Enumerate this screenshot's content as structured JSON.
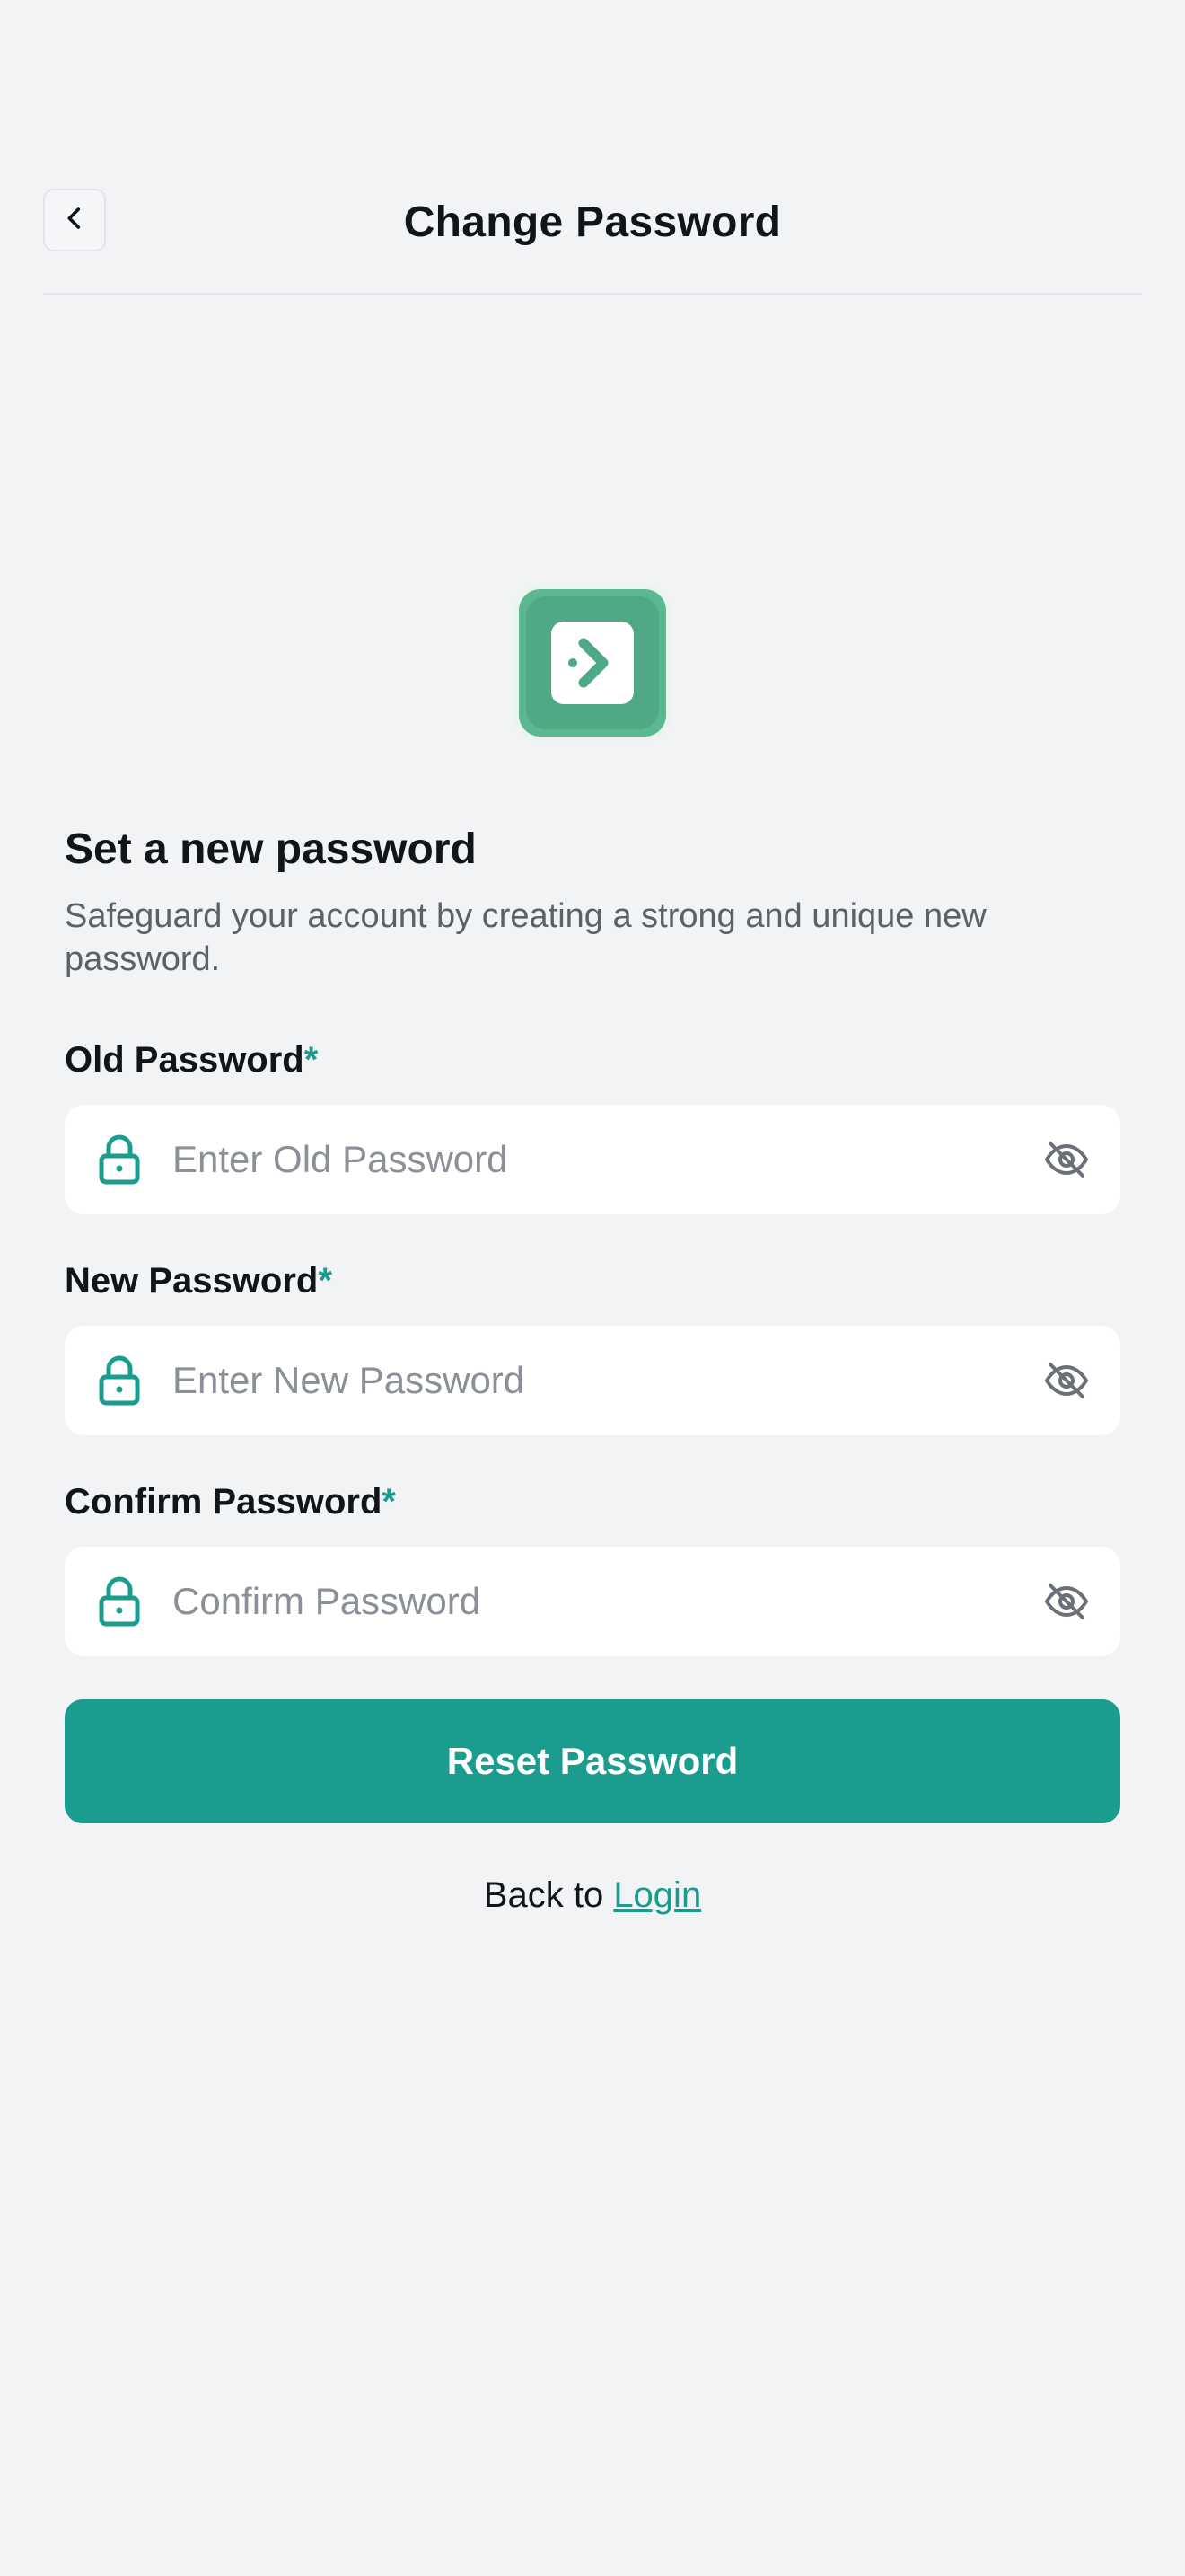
{
  "header": {
    "title": "Change Password",
    "back_icon": "chevron-left-icon"
  },
  "logo": {
    "icon": "app-logo-icon",
    "colors": {
      "outer": "#5bb891",
      "inner": "#4fa984",
      "mark": "#ffffff"
    }
  },
  "intro": {
    "title": "Set a new password",
    "description": "Safeguard your account by creating a strong and unique new password."
  },
  "fields": [
    {
      "label": "Old Password",
      "required_mark": "*",
      "placeholder": "Enter Old Password",
      "value": ""
    },
    {
      "label": "New Password",
      "required_mark": "*",
      "placeholder": "Enter New Password",
      "value": ""
    },
    {
      "label": "Confirm Password",
      "required_mark": "*",
      "placeholder": "Confirm Password",
      "value": ""
    }
  ],
  "actions": {
    "reset_label": "Reset Password",
    "back_prefix": "Back to ",
    "login_link": "Login"
  },
  "colors": {
    "accent": "#1a9c8e",
    "background": "#f2f3f5",
    "field_bg": "#ffffff",
    "placeholder": "#8a8f98"
  }
}
